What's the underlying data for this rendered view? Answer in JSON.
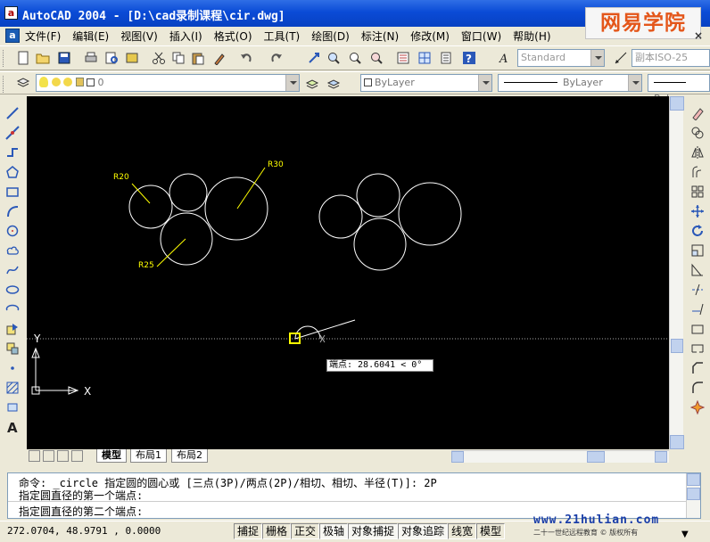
{
  "window": {
    "app_icon": "a",
    "title": "AutoCAD 2004 - [D:\\cad录制课程\\cir.dwg]",
    "brand_logo": "网易学院",
    "logo_close": "×"
  },
  "menubar": {
    "items": [
      "文件(F)",
      "编辑(E)",
      "视图(V)",
      "插入(I)",
      "格式(O)",
      "工具(T)",
      "绘图(D)",
      "标注(N)",
      "修改(M)",
      "窗口(W)",
      "帮助(H)"
    ]
  },
  "toolbar1": {
    "text_style_value": "Standard",
    "dim_style_value": "副本ISO-25"
  },
  "toolbar2": {
    "layer_value": "0",
    "color_value": "ByLayer",
    "linetype_value": "ByLayer",
    "lineweight_value": "ByLa"
  },
  "drawing": {
    "labels": {
      "r20": "R20",
      "r30": "R30",
      "r25": "R25"
    },
    "ucs_y": "Y",
    "ucs_x": "X",
    "tooltip": "端点: 28.6041 < 0°"
  },
  "tabs": {
    "items": [
      "模型",
      "布局1",
      "布局2"
    ],
    "active": "模型"
  },
  "command": {
    "lines": [
      "命令: _circle 指定圆的圆心或 [三点(3P)/两点(2P)/相切、相切、半径(T)]: 2P",
      "指定圆直径的第一个端点:",
      "指定圆直径的第二个端点:"
    ]
  },
  "statusbar": {
    "coords": "272.0704, 48.9791 , 0.0000",
    "toggles": [
      "捕捉",
      "栅格",
      "正交",
      "极轴",
      "对象捕捉",
      "对象追踪",
      "线宽",
      "模型"
    ]
  },
  "footer": {
    "url": "www.21hulian.com",
    "tagline": "二十一世纪远程教育 © 版权所有"
  },
  "colors": {
    "accent_title": "#0a4bd6",
    "canvas": "#000000",
    "geometry": "#ffffff",
    "dimension": "#ffff00"
  }
}
